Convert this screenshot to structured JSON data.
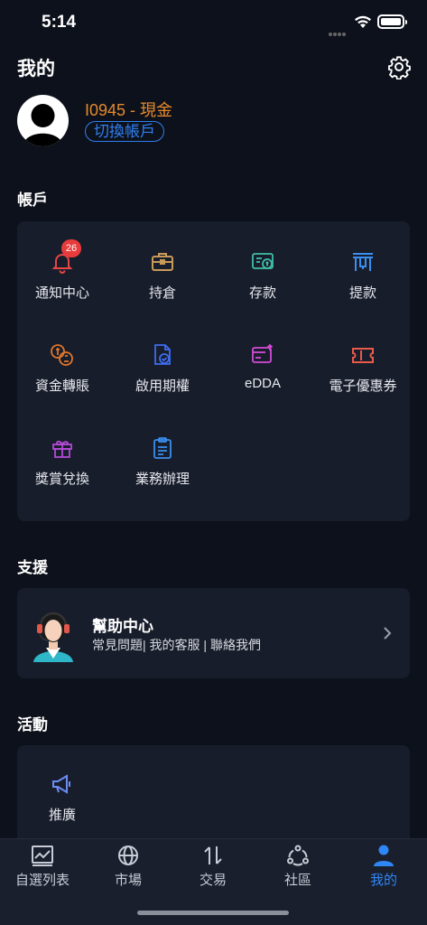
{
  "status": {
    "time": "5:14"
  },
  "header": {
    "title": "我的"
  },
  "account": {
    "id": "I0945 - 現金",
    "switch_label": "切換帳戶"
  },
  "sections": {
    "accounts": "帳戶",
    "support": "支援",
    "activities": "活動"
  },
  "account_grid": [
    {
      "label": "通知中心",
      "icon": "bell-icon",
      "badge": "26",
      "color": "#e84545"
    },
    {
      "label": "持倉",
      "icon": "briefcase-icon",
      "color": "#c89a5a"
    },
    {
      "label": "存款",
      "icon": "deposit-icon",
      "color": "#3fbfa8"
    },
    {
      "label": "提款",
      "icon": "withdraw-icon",
      "color": "#3a8ff0"
    },
    {
      "label": "資金轉賬",
      "icon": "currency-transfer-icon",
      "color": "#e0762a"
    },
    {
      "label": "啟用期權",
      "icon": "document-check-icon",
      "color": "#3d6cf0"
    },
    {
      "label": "eDDA",
      "icon": "card-upload-icon",
      "color": "#d54ad8"
    },
    {
      "label": "電子優惠券",
      "icon": "ticket-icon",
      "color": "#e85a4a"
    },
    {
      "label": "獎賞兌換",
      "icon": "gift-icon",
      "color": "#b44ad8"
    },
    {
      "label": "業務辦理",
      "icon": "clipboard-icon",
      "color": "#3a8ff0"
    }
  ],
  "help": {
    "title": "幫助中心",
    "subtitle": "常見問題| 我的客服 | 聯絡我們"
  },
  "activity": {
    "promo_label": "推廣",
    "icon": "megaphone-icon"
  },
  "tabs": [
    {
      "label": "自選列表",
      "icon": "chart-icon"
    },
    {
      "label": "市場",
      "icon": "globe-icon"
    },
    {
      "label": "交易",
      "icon": "swap-arrows-icon"
    },
    {
      "label": "社區",
      "icon": "community-icon"
    },
    {
      "label": "我的",
      "icon": "person-icon",
      "active": true
    }
  ],
  "colors": {
    "accent": "#2f86f6",
    "account_id": "#e58a2c",
    "background": "#0d111b",
    "card": "#181d2b"
  }
}
